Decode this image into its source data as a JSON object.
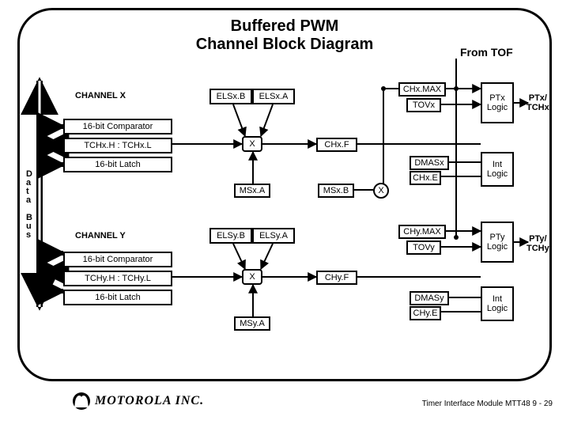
{
  "title_line1": "Buffered PWM",
  "title_line2": "Channel Block Diagram",
  "from_tof": "From TOF",
  "data_bus_label": "D\na\nt\na\n\nB\nu\ns",
  "ch_x": {
    "label": "CHANNEL X",
    "els_b": "ELSx.B",
    "els_a": "ELSx.A",
    "ch_max": "CHx.MAX",
    "tov": "TOVx",
    "comparator": "16-bit Comparator",
    "tch": "TCHx.H : TCHx.L",
    "latch": "16-bit Latch",
    "mux": "X",
    "chf": "CHx.F",
    "dmas": "DMASx",
    "che": "CHx.E",
    "msa": "MSx.A",
    "msb": "MSx.B",
    "msb_disc": "X",
    "pt_logic": "PTx\nLogic",
    "int_logic": "Int\nLogic",
    "pt_out": "PTx/\nTCHx"
  },
  "ch_y": {
    "label": "CHANNEL Y",
    "els_b": "ELSy.B",
    "els_a": "ELSy.A",
    "ch_max": "CHy.MAX",
    "tov": "TOVy",
    "comparator": "16-bit Comparator",
    "tch": "TCHy.H : TCHy.L",
    "latch": "16-bit Latch",
    "mux": "X",
    "chf": "CHy.F",
    "dmas": "DMASy",
    "che": "CHy.E",
    "msa": "MSy.A",
    "pt_logic": "PTy\nLogic",
    "int_logic": "Int\nLogic",
    "pt_out": "PTy/\nTCHy"
  },
  "logo_text": "MOTOROLA INC.",
  "footer": "Timer Interface Module MTT48 9 - 29"
}
